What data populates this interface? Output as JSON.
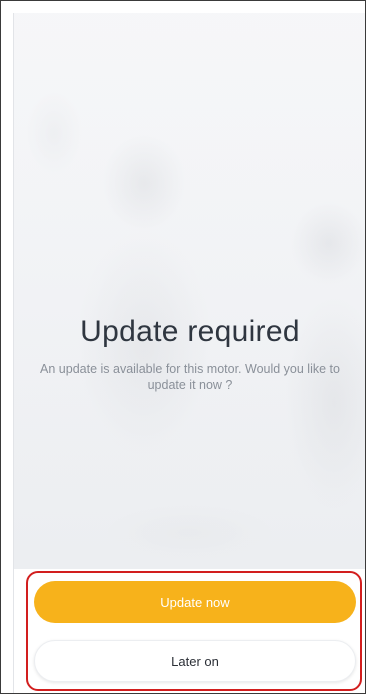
{
  "dialog": {
    "title": "Update required",
    "message": "An update is available for this motor. Would you like to update it now ?"
  },
  "actions": {
    "update_now_label": "Update now",
    "later_on_label": "Later on"
  },
  "colors": {
    "primary_button": "#f7b21b",
    "highlight_border": "#d21e1e",
    "title_text": "#2f3640",
    "message_text": "#8a9099"
  }
}
